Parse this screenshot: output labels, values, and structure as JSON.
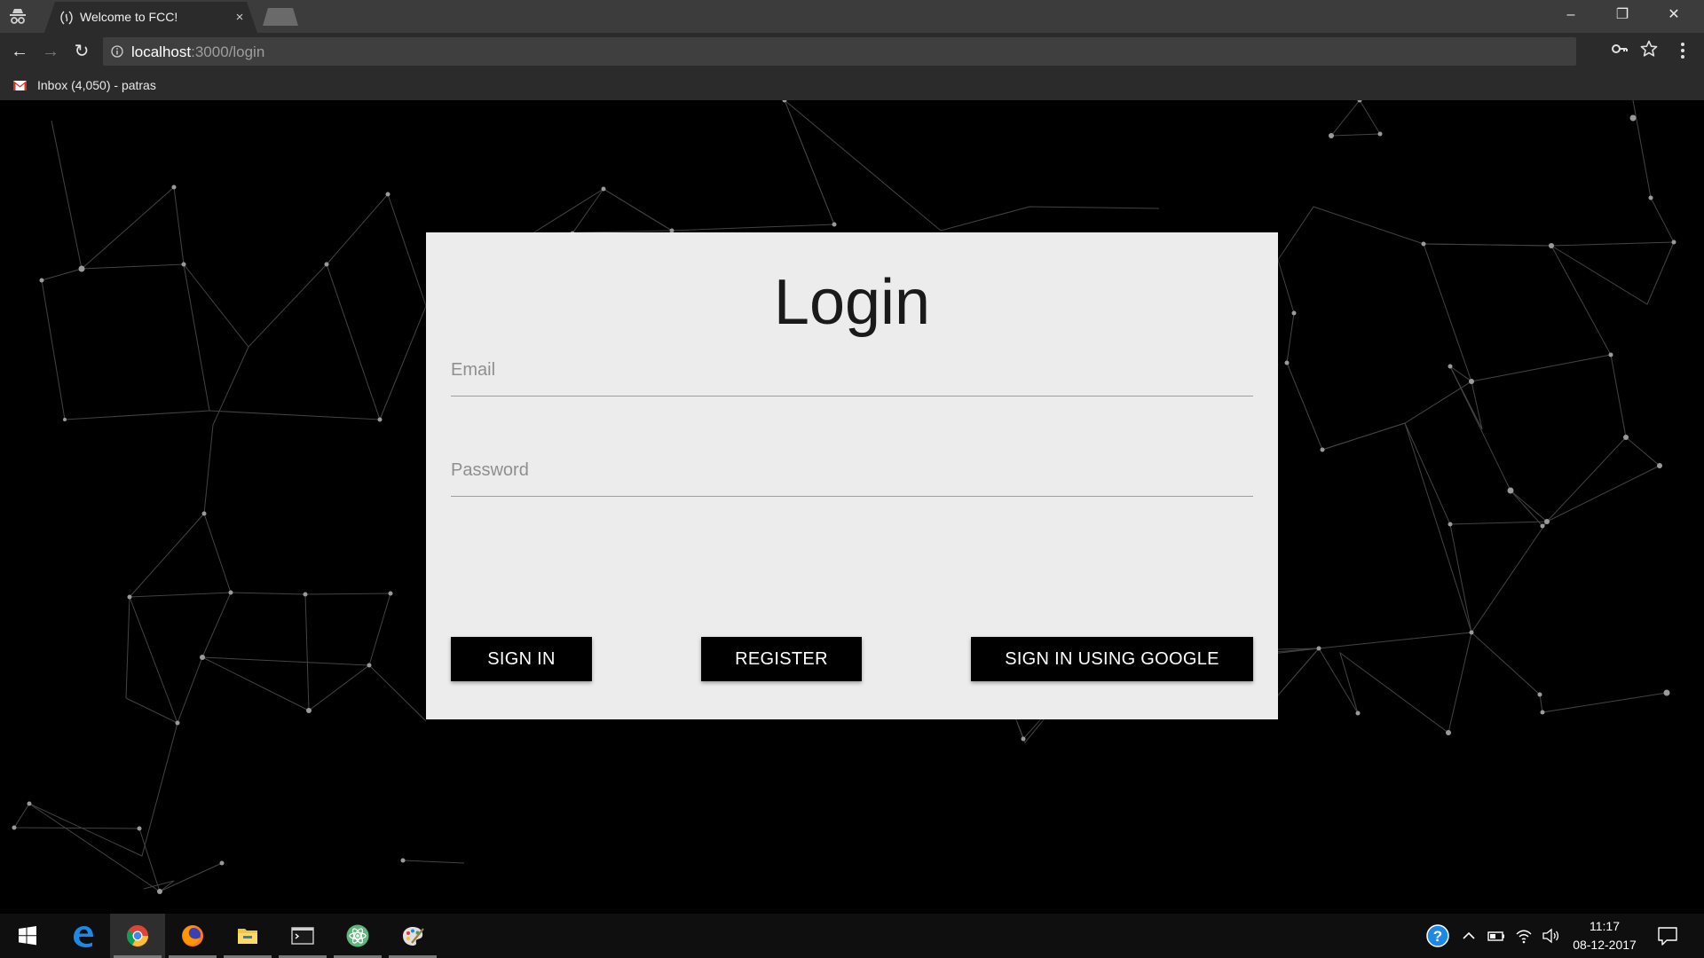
{
  "browser": {
    "tab_title": "Welcome to FCC!",
    "tab_close": "×",
    "url_host": "localhost",
    "url_path": ":3000/login",
    "bookmark_label": "Inbox (4,050) - patras",
    "window_controls": {
      "minimize": "–",
      "restore": "❐",
      "close": "✕"
    },
    "nav": {
      "back": "←",
      "forward": "→",
      "reload": "↻"
    }
  },
  "login": {
    "title": "Login",
    "email_placeholder": "Email",
    "password_placeholder": "Password",
    "sign_in_label": "SIGN IN",
    "register_label": "REGISTER",
    "google_label": "SIGN IN USING GOOGLE"
  },
  "taskbar": {
    "apps": [
      "start",
      "edge",
      "chrome",
      "firefox",
      "file-explorer",
      "terminal",
      "atom",
      "paint"
    ],
    "active_app": "chrome",
    "time": "11:17",
    "date": "08-12-2017"
  },
  "colors": {
    "page_background": "#000000",
    "card_background": "#ececec",
    "button_background": "#000000",
    "button_text": "#ffffff",
    "network_lines": "#5a5a5a"
  }
}
